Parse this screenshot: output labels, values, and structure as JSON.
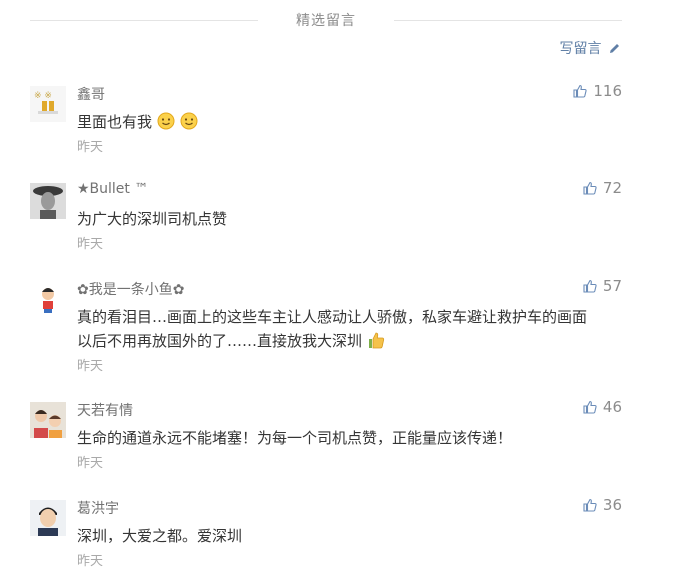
{
  "section": {
    "title": "精选留言",
    "write_label": "写留言"
  },
  "comments": [
    {
      "nickname": "鑫哥",
      "content": "里面也有我",
      "time": "昨天",
      "likes": "116"
    },
    {
      "nickname": "★Bullet ™",
      "content": "为广大的深圳司机点赞",
      "time": "昨天",
      "likes": "72"
    },
    {
      "nickname": "✿我是一条小鱼✿",
      "content_line1": "真的看泪目…画面上的这些车主让人感动让人骄傲，私家车避让救护车的画面",
      "content_line2": "以后不用再放国外的了……直接放我大深圳",
      "time": "昨天",
      "likes": "57"
    },
    {
      "nickname": "天若有情",
      "content": "生命的通道永远不能堵塞！为每一个司机点赞，正能量应该传递！",
      "time": "昨天",
      "likes": "46"
    },
    {
      "nickname": "葛洪宇",
      "content": "深圳，大爱之都。爱深圳",
      "time": "昨天",
      "likes": "36"
    }
  ],
  "colors": {
    "link": "#607fa6",
    "time": "#a9a9a9",
    "nickname": "#727272"
  },
  "icons": [
    "pencil-icon",
    "thumbs-up-icon",
    "smile-emoji-icon",
    "thumbs-up-emoji-icon"
  ]
}
